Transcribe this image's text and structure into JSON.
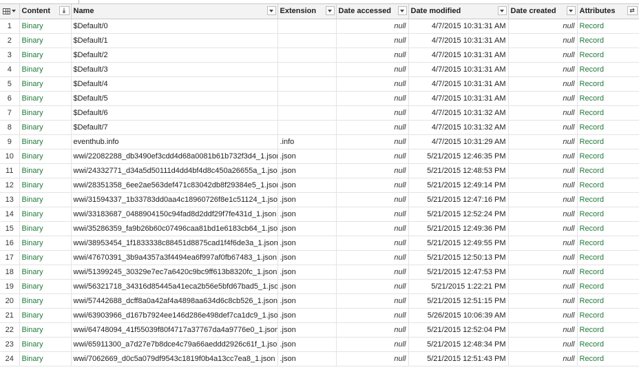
{
  "header": {
    "content": "Content",
    "name": "Name",
    "extension": "Extension",
    "date_accessed": "Date accessed",
    "date_modified": "Date modified",
    "date_created": "Date created",
    "attributes": "Attributes"
  },
  "icons": {
    "table": "table-icon",
    "sort": "expand-binary-icon",
    "expand": "expand-columns-icon"
  },
  "colors": {
    "link": "#217a3c",
    "header_bg": "#f3f3f3"
  },
  "rows": [
    {
      "num": "1",
      "content": "Binary",
      "name": "$Default/0",
      "ext": "",
      "accessed": "null",
      "modified": "4/7/2015 10:31:31 AM",
      "created": "null",
      "attributes": "Record"
    },
    {
      "num": "2",
      "content": "Binary",
      "name": "$Default/1",
      "ext": "",
      "accessed": "null",
      "modified": "4/7/2015 10:31:31 AM",
      "created": "null",
      "attributes": "Record"
    },
    {
      "num": "3",
      "content": "Binary",
      "name": "$Default/2",
      "ext": "",
      "accessed": "null",
      "modified": "4/7/2015 10:31:31 AM",
      "created": "null",
      "attributes": "Record"
    },
    {
      "num": "4",
      "content": "Binary",
      "name": "$Default/3",
      "ext": "",
      "accessed": "null",
      "modified": "4/7/2015 10:31:31 AM",
      "created": "null",
      "attributes": "Record"
    },
    {
      "num": "5",
      "content": "Binary",
      "name": "$Default/4",
      "ext": "",
      "accessed": "null",
      "modified": "4/7/2015 10:31:31 AM",
      "created": "null",
      "attributes": "Record"
    },
    {
      "num": "6",
      "content": "Binary",
      "name": "$Default/5",
      "ext": "",
      "accessed": "null",
      "modified": "4/7/2015 10:31:31 AM",
      "created": "null",
      "attributes": "Record"
    },
    {
      "num": "7",
      "content": "Binary",
      "name": "$Default/6",
      "ext": "",
      "accessed": "null",
      "modified": "4/7/2015 10:31:32 AM",
      "created": "null",
      "attributes": "Record"
    },
    {
      "num": "8",
      "content": "Binary",
      "name": "$Default/7",
      "ext": "",
      "accessed": "null",
      "modified": "4/7/2015 10:31:32 AM",
      "created": "null",
      "attributes": "Record"
    },
    {
      "num": "9",
      "content": "Binary",
      "name": "eventhub.info",
      "ext": ".info",
      "accessed": "null",
      "modified": "4/7/2015 10:31:29 AM",
      "created": "null",
      "attributes": "Record"
    },
    {
      "num": "10",
      "content": "Binary",
      "name": "wwi/22082288_db3490ef3cdd4d68a0081b61b732f3d4_1.json",
      "ext": ".json",
      "accessed": "null",
      "modified": "5/21/2015 12:46:35 PM",
      "created": "null",
      "attributes": "Record"
    },
    {
      "num": "11",
      "content": "Binary",
      "name": "wwi/24332771_d34a5d50111d4dd4bf4d8c450a26655a_1.json",
      "ext": ".json",
      "accessed": "null",
      "modified": "5/21/2015 12:48:53 PM",
      "created": "null",
      "attributes": "Record"
    },
    {
      "num": "12",
      "content": "Binary",
      "name": "wwi/28351358_6ee2ae563def471c83042db8f29384e5_1.json",
      "ext": ".json",
      "accessed": "null",
      "modified": "5/21/2015 12:49:14 PM",
      "created": "null",
      "attributes": "Record"
    },
    {
      "num": "13",
      "content": "Binary",
      "name": "wwi/31594337_1b33783dd0aa4c18960726f8e1c51124_1.json",
      "ext": ".json",
      "accessed": "null",
      "modified": "5/21/2015 12:47:16 PM",
      "created": "null",
      "attributes": "Record"
    },
    {
      "num": "14",
      "content": "Binary",
      "name": "wwi/33183687_0488904150c94fad8d2ddf29f7fe431d_1.json",
      "ext": ".json",
      "accessed": "null",
      "modified": "5/21/2015 12:52:24 PM",
      "created": "null",
      "attributes": "Record"
    },
    {
      "num": "15",
      "content": "Binary",
      "name": "wwi/35286359_fa9b26b60c07496caa81bd1e6183cb64_1.json",
      "ext": ".json",
      "accessed": "null",
      "modified": "5/21/2015 12:49:36 PM",
      "created": "null",
      "attributes": "Record"
    },
    {
      "num": "16",
      "content": "Binary",
      "name": "wwi/38953454_1f1833338c88451d8875cad1f4f6de3a_1.json",
      "ext": ".json",
      "accessed": "null",
      "modified": "5/21/2015 12:49:55 PM",
      "created": "null",
      "attributes": "Record"
    },
    {
      "num": "17",
      "content": "Binary",
      "name": "wwi/47670391_3b9a4357a3f4494ea6f997af0fb67483_1.json",
      "ext": ".json",
      "accessed": "null",
      "modified": "5/21/2015 12:50:13 PM",
      "created": "null",
      "attributes": "Record"
    },
    {
      "num": "18",
      "content": "Binary",
      "name": "wwi/51399245_30329e7ec7a6420c9bc9ff613b8320fc_1.json",
      "ext": ".json",
      "accessed": "null",
      "modified": "5/21/2015 12:47:53 PM",
      "created": "null",
      "attributes": "Record"
    },
    {
      "num": "19",
      "content": "Binary",
      "name": "wwi/56321718_34316d85445a41eca2b56e5bfd67bad5_1.json",
      "ext": ".json",
      "accessed": "null",
      "modified": "5/21/2015 1:22:21 PM",
      "created": "null",
      "attributes": "Record"
    },
    {
      "num": "20",
      "content": "Binary",
      "name": "wwi/57442688_dcff8a0a42af4a4898aa634d6c8cb526_1.json",
      "ext": ".json",
      "accessed": "null",
      "modified": "5/21/2015 12:51:15 PM",
      "created": "null",
      "attributes": "Record"
    },
    {
      "num": "21",
      "content": "Binary",
      "name": "wwi/63903966_d167b7924ee146d286e498def7ca1dc9_1.json",
      "ext": ".json",
      "accessed": "null",
      "modified": "5/26/2015 10:06:39 AM",
      "created": "null",
      "attributes": "Record"
    },
    {
      "num": "22",
      "content": "Binary",
      "name": "wwi/64748094_41f55039f80f4717a37767da4a9776e0_1.json",
      "ext": ".json",
      "accessed": "null",
      "modified": "5/21/2015 12:52:04 PM",
      "created": "null",
      "attributes": "Record"
    },
    {
      "num": "23",
      "content": "Binary",
      "name": "wwi/65911300_a7d27e7b8dce4c79a66aeddd2926c61f_1.json",
      "ext": ".json",
      "accessed": "null",
      "modified": "5/21/2015 12:48:34 PM",
      "created": "null",
      "attributes": "Record"
    },
    {
      "num": "24",
      "content": "Binary",
      "name": "wwi/7062669_d0c5a079df9543c1819f0b4a13cc7ea8_1.json",
      "ext": ".json",
      "accessed": "null",
      "modified": "5/21/2015 12:51:43 PM",
      "created": "null",
      "attributes": "Record"
    }
  ]
}
